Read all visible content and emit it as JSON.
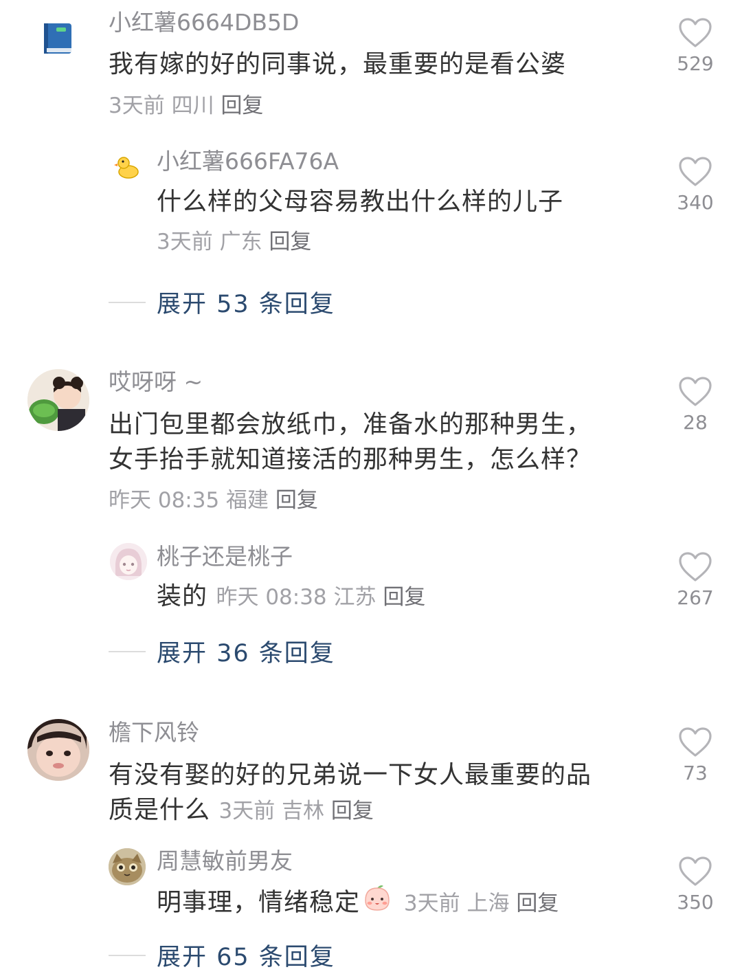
{
  "comments": [
    {
      "username": "小红薯6664DB5D",
      "text": "我有嫁的好的同事说，最重要的是看公婆",
      "meta": "3天前 四川",
      "reply_label": "回复",
      "likes": "529",
      "avatar": "book-icon",
      "replies": [
        {
          "username": "小红薯666FA76A",
          "text": "什么样的父母容易教出什么样的儿子",
          "meta": "3天前 广东",
          "reply_label": "回复",
          "likes": "340",
          "avatar": "duck-icon"
        }
      ],
      "expand_label": "展开 53 条回复"
    },
    {
      "username": "哎呀呀 ~",
      "text_lines": [
        "出门包里都会放纸巾，准备水的那种男生，",
        "女手抬手就知道接活的那种男生，怎么样？"
      ],
      "meta": "昨天 08:35 福建",
      "reply_label": "回复",
      "likes": "28",
      "avatar": "girl-photo",
      "replies": [
        {
          "username": "桃子还是桃子",
          "text": "装的",
          "meta": "昨天 08:38 江苏",
          "reply_label": "回复",
          "likes": "267",
          "avatar": "anime-girl-avatar"
        }
      ],
      "expand_label": "展开 36 条回复"
    },
    {
      "username": "檐下风铃",
      "text_lines": [
        "有没有娶的好的兄弟说一下女人最重要的品",
        "质是什么"
      ],
      "meta": "3天前 吉林",
      "reply_label": "回复",
      "likes": "73",
      "avatar": "child-photo",
      "replies": [
        {
          "username": "周慧敏前男友",
          "text": "明事理，情绪稳定",
          "emoji": "peach-face-emoji",
          "meta": "3天前 上海",
          "reply_label": "回复",
          "likes": "350",
          "avatar": "cat-photo"
        }
      ],
      "expand_label": "展开 65 条回复"
    }
  ],
  "colors": {
    "username": "#8e8e93",
    "content": "#333333",
    "meta": "#a1a1a6",
    "expand": "#2b4a6f",
    "heart": "#b8b8bc"
  }
}
